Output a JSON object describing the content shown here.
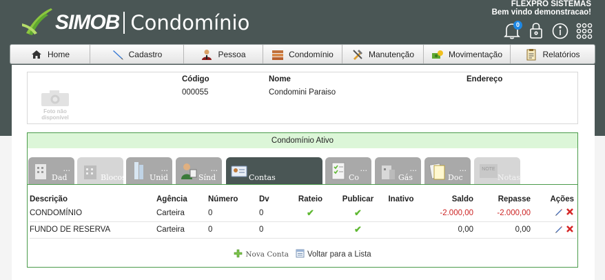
{
  "brand": {
    "logo_text": "SIMOB",
    "product": "Condomínio"
  },
  "user": {
    "company": "FLEXPRO SISTEMAS",
    "welcome": "Bem vindo demonstracao!"
  },
  "notifications": {
    "count": "0"
  },
  "menu": [
    {
      "label": "Home",
      "icon": "home-icon"
    },
    {
      "label": "Cadastro",
      "icon": "pen-icon"
    },
    {
      "label": "Pessoa",
      "icon": "person-icon"
    },
    {
      "label": "Condomínio",
      "icon": "building-stack-icon"
    },
    {
      "label": "Manutenção",
      "icon": "tools-icon"
    },
    {
      "label": "Movimentação",
      "icon": "money-icon"
    },
    {
      "label": "Relatórios",
      "icon": "report-icon"
    }
  ],
  "info": {
    "headers": {
      "codigo": "Código",
      "nome": "Nome",
      "endereco": "Endereço"
    },
    "codigo": "000055",
    "nome": "Condomini Paraiso",
    "endereco": "",
    "no_photo": [
      "Foto não",
      "disponível"
    ]
  },
  "condominio": {
    "title": "Condomínio Ativo",
    "tabs": [
      {
        "label": "Dad",
        "dots": "..."
      },
      {
        "label": "Blocos",
        "dots": ""
      },
      {
        "label": "Unid",
        "dots": "..."
      },
      {
        "label": "Sínd",
        "dots": "..."
      },
      {
        "label": "Contas",
        "dots": ""
      },
      {
        "label": "Co",
        "dots": "..."
      },
      {
        "label": "Gás",
        "dots": "..."
      },
      {
        "label": "Doc",
        "dots": "..."
      },
      {
        "label": "Notas",
        "dots": ""
      }
    ],
    "table": {
      "headers": [
        "Descrição",
        "Agência",
        "Número",
        "Dv",
        "Rateio",
        "Publicar",
        "Inativo",
        "Saldo",
        "Repasse",
        "Ações"
      ],
      "rows": [
        {
          "descricao": "CONDOMÍNIO",
          "agencia": "Carteira",
          "numero": "0",
          "dv": "0",
          "rateio": true,
          "publicar": true,
          "inativo": false,
          "saldo": "-2.000,00",
          "repasse": "-2.000,00"
        },
        {
          "descricao": "FUNDO DE RESERVA",
          "agencia": "Carteira",
          "numero": "0",
          "dv": "0",
          "rateio": false,
          "publicar": true,
          "inativo": false,
          "saldo": "0,00",
          "repasse": "0,00"
        }
      ]
    },
    "actions": {
      "new_account": "Nova Conta",
      "back_to_list": "Voltar para a Lista"
    }
  },
  "colors": {
    "header_bg": "#4a5655",
    "active_tab": "#4a5655",
    "negative": "#cc2222",
    "success_bg": "#dcf6d8",
    "border_green": "#4a9a4a",
    "check": "#5fb832"
  }
}
